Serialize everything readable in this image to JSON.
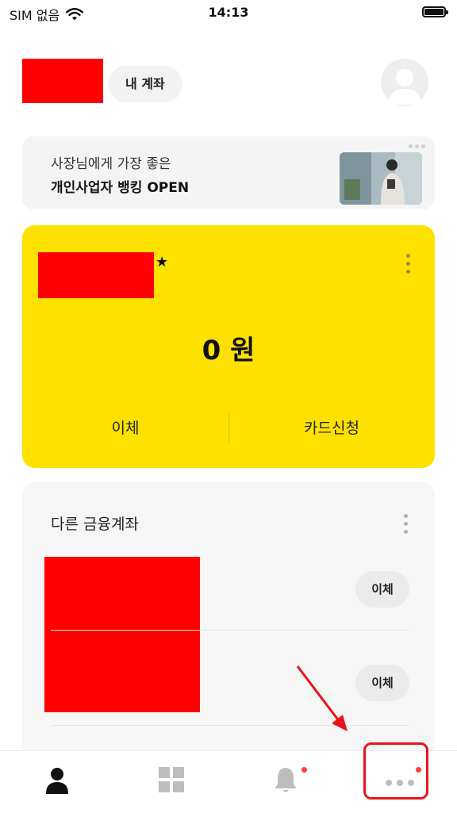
{
  "status_bar": {
    "carrier": "SIM 없음",
    "time": "14:13"
  },
  "header": {
    "my_account_label": "내 계좌"
  },
  "banner": {
    "line1": "사장님에게 가장 좋은",
    "line2": "개인사업자 뱅킹 OPEN"
  },
  "main_account": {
    "balance": "0 원",
    "actions": [
      "이체",
      "카드신청"
    ]
  },
  "other_accounts": {
    "title": "다른 금융계좌",
    "rows": [
      {
        "action_label": "이체"
      },
      {
        "action_label": "이체"
      }
    ]
  },
  "bottom_nav": {
    "items": [
      {
        "icon": "person-icon",
        "active": true
      },
      {
        "icon": "grid-icon",
        "active": false
      },
      {
        "icon": "bell-icon",
        "active": false,
        "badge": true
      },
      {
        "icon": "more-icon",
        "active": false,
        "badge": true
      }
    ]
  },
  "colors": {
    "card_yellow": "#ffe100",
    "redaction": "#ff0000",
    "annotation_red": "#e8141b",
    "badge_red": "#ff3b3b"
  }
}
